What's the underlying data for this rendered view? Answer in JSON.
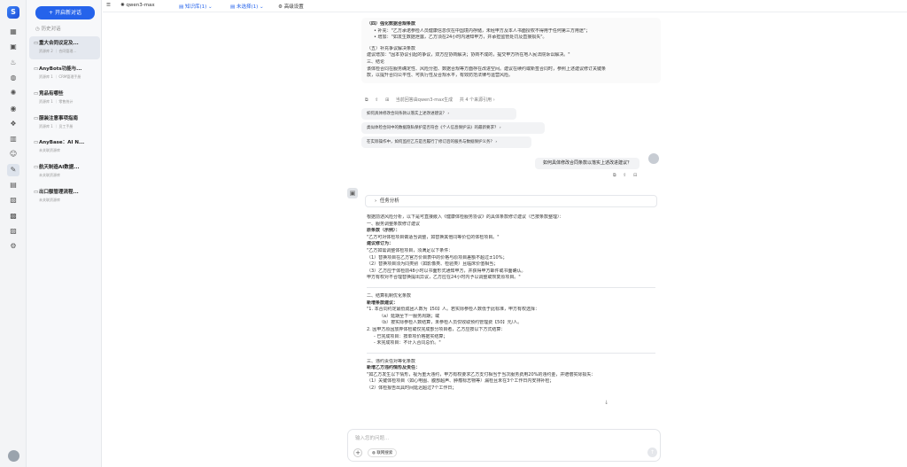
{
  "rail": {
    "logo": "S",
    "icons": [
      {
        "name": "grid-icon",
        "glyph": "▦"
      },
      {
        "name": "box-icon",
        "glyph": "▣"
      },
      {
        "name": "fire-icon",
        "glyph": "♨"
      },
      {
        "name": "globe-icon",
        "glyph": "◍"
      },
      {
        "name": "gear-icon",
        "glyph": "✺"
      },
      {
        "name": "shield-icon",
        "glyph": "◉"
      },
      {
        "name": "network-icon",
        "glyph": "❖"
      },
      {
        "name": "library-icon",
        "glyph": "▥"
      },
      {
        "name": "user-icon",
        "glyph": "☺"
      },
      {
        "name": "chat-icon",
        "glyph": "✎"
      },
      {
        "name": "document-icon",
        "glyph": "▤"
      },
      {
        "name": "image-icon",
        "glyph": "▧"
      },
      {
        "name": "ticket-icon",
        "glyph": "▩"
      },
      {
        "name": "chart-icon",
        "glyph": "▨"
      },
      {
        "name": "settings-icon",
        "glyph": "⚙"
      }
    ]
  },
  "sidebar": {
    "new_chat": "+ 开启新对话",
    "history_label": "历史对话",
    "conversations": [
      {
        "title": "重大合同议定及...",
        "sub": "资源库 2 ｜ 合同管理..."
      },
      {
        "title": "AnyBots功能与...",
        "sub": "资源库 1 ｜ CRM管理手册"
      },
      {
        "title": "竞品有哪些",
        "sub": "资源库 1 ｜ 零售统计"
      },
      {
        "title": "服装注意事项指南",
        "sub": "资源库 1 ｜ 员工手册"
      },
      {
        "title": "AnyBase：AI N...",
        "sub": "未关联资源库"
      },
      {
        "title": "航天制造AI数据...",
        "sub": "未关联资源库"
      },
      {
        "title": "出口额管理流程...",
        "sub": "未关联资源库"
      }
    ]
  },
  "topbar": {
    "model": "qwen3-max",
    "knowledge": "知识库(1)",
    "selection": "未选择(1)",
    "advanced": "高级设置"
  },
  "message1": {
    "lines": [
      {
        "t": "（四）强化数据合规条款",
        "c": "b"
      },
      {
        "t": "• 补充：\"乙方承诺参检人员健康信息仅在中国境内存储，未经甲方及本人书面授权不得用于任何第三方用途\"；",
        "c": "ind1"
      },
      {
        "t": "• 增加：\"如发生数据泄露，乙方须在24小时内通知甲方，并承担监管处罚及直接损失\"。",
        "c": "ind1"
      },
      {
        "t": "",
        "c": "gap"
      },
      {
        "t": "（五）补充争议解决条款",
        "c": ""
      },
      {
        "t": "建议增加：\"因本协议引起的争议，双方应协商解决；协商不成的，提交甲方所在地人民法院诉讼解决。\"",
        "c": ""
      },
      {
        "t": "三、结论",
        "c": ""
      },
      {
        "t": "该体检合同在服务确定性、风险分担、数据合规等方面存在改进空间。建议在续约或新签合同时，参照上述建议修订关键条",
        "c": ""
      },
      {
        "t": "款，以提升合同公平性、可执行性及合规水平，有效防范法律与运营风险。",
        "c": ""
      }
    ],
    "actions": [
      "⧉",
      "⇪",
      "⊞",
      "当前回答由qwen3-max生成",
      "共 4 个来源引用 ›"
    ]
  },
  "suggestions": [
    "如何具体修改合同条款以落实上述改进建议？ ›",
    "类似体检合同中的数据隐私保护是否符合《个人信息保护法》的最新要求？ ›",
    "在实际操作中，如何监控乙方是否履行了修订后的服务与数据保护义务？ ›"
  ],
  "user_question": "如何具体修改合同条款以落实上述改进建议？",
  "user_actions": [
    "⧉",
    "⇪",
    "⊟"
  ],
  "task_label": "任务分析",
  "answer": {
    "lines": [
      {
        "t": "根据前述风险分析，以下是可直接嵌入《健康体检服务协议》的具体条款修订建议（已按条款整理）：",
        "c": ""
      },
      {
        "t": "一、服务调整条款修订建议",
        "c": ""
      },
      {
        "t": "原条款（示例）：",
        "c": "b"
      },
      {
        "t": "\"乙方可对体检项目做适当调整，如替换其他同等价位的体检项目。\"",
        "c": ""
      },
      {
        "t": "建议修订为：",
        "c": "b"
      },
      {
        "t": "\"乙方如需调整体检项目，须满足以下条件：",
        "c": ""
      },
      {
        "t": "（1）替换项目在乙方官方价目表中的价格与原项目差额不超过±10%；",
        "c": ""
      },
      {
        "t": "（2）替换项目须为同类别（如影像类、检验类）且临床价值相当；",
        "c": ""
      },
      {
        "t": "（3）乙方应于体检前48小时以书面形式通知甲方，并获得甲方邮件或书面确认。",
        "c": ""
      },
      {
        "t": "甲方有权对不合理替换提出异议，乙方应在24小时内予以调整或恢复原项目。\"",
        "c": ""
      },
      {
        "t": "",
        "c": "hr"
      },
      {
        "t": "二、结算机制优化条款",
        "c": ""
      },
      {
        "t": "新增条款建议：",
        "c": "b"
      },
      {
        "t": "\"1. 本合同约定最低成团人数为【50】人。若实际参检人数低于此标准，甲方有权选择：",
        "c": ""
      },
      {
        "t": "（a）延期至下一服务周期；或",
        "c": "ind2"
      },
      {
        "t": "（b）按实际参检人数结算，未参检人员仅收取预约管理费【50】元/人。",
        "c": "ind2"
      },
      {
        "t": "2. 因甲方原因放弃体检或仅完成部分项目者，乙方应按以下方式结算：",
        "c": ""
      },
      {
        "t": "- 已完成项目：按单项价格据实结算；",
        "c": "ind1"
      },
      {
        "t": "- 未完成项目：不计入合同总价。\"",
        "c": "ind1"
      },
      {
        "t": "",
        "c": "hr"
      },
      {
        "t": "三、违约责任对等化条款",
        "c": ""
      },
      {
        "t": "新增乙方违约情形及责任：",
        "c": "b"
      },
      {
        "t": "\"如乙方发生以下情形，视为重大违约，甲方有权要求乙方支付相当于当次服务费用20%的违约金，并赔偿实际损失：",
        "c": ""
      },
      {
        "t": "（1）关键体检项目（如心电图、腹部超声、肿瘤标志物等）漏检且未在3个工作日内安排补检；",
        "c": ""
      },
      {
        "t": "（2）体检报告出具时间延迟超过7个工作日；",
        "c": ""
      }
    ]
  },
  "input": {
    "placeholder": "输入您的问题...",
    "web_search": "联网搜索"
  }
}
